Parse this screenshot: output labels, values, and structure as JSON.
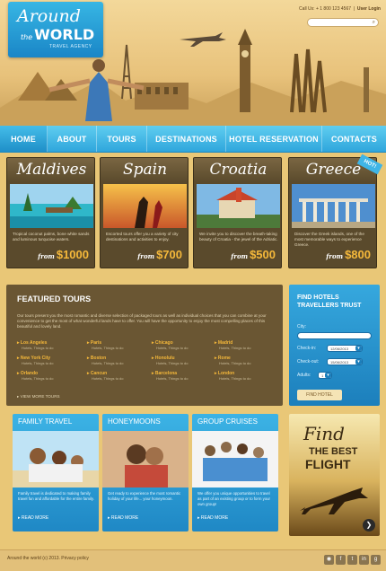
{
  "header": {
    "logo_line1": "Around",
    "logo_the": "the",
    "logo_line2": "WORLD",
    "logo_tagline": "TRAVEL AGENCY",
    "call_us": "Call Us: + 1 800 123 4567",
    "user_login": "User Login"
  },
  "nav": {
    "items": [
      "HOME",
      "ABOUT",
      "TOURS",
      "DESTINATIONS",
      "HOTEL RESERVATION",
      "CONTACTS"
    ]
  },
  "destinations": [
    {
      "name": "Maldives",
      "text": "Tropical coconut palms, bone white sands and luminous turquoise waters.",
      "from": "from",
      "price": "$1000"
    },
    {
      "name": "Spain",
      "text": "Escorted tours offer you a variety of city destinations and activities to enjoy.",
      "from": "from",
      "price": "$700"
    },
    {
      "name": "Croatia",
      "text": "We invite you to discover the breath-taking beauty of Croatia - the jewel of the Adriatic.",
      "from": "from",
      "price": "$500"
    },
    {
      "name": "Greece",
      "text": "Discover the Greek islands, one of the most memorable ways to experience Greece.",
      "from": "from",
      "price": "$800"
    }
  ],
  "hot_badge": "HOT!",
  "featured": {
    "title": "FEATURED TOURS",
    "description": "Our tours present you the most romantic and diverse selection of packaged tours as well as individual choices that you can combine at your convenience to get the most of what wonderful lands have to offer. You will have the opportunity to enjoy the most compelling places of this beautiful and lovely land.",
    "cities": [
      {
        "city": "Los Angeles",
        "sub": "Hotels, Things to do"
      },
      {
        "city": "Paris",
        "sub": "Hotels, Things to do"
      },
      {
        "city": "Chicago",
        "sub": "Hotels, Things to do"
      },
      {
        "city": "Madrid",
        "sub": "Hotels, Things to do"
      },
      {
        "city": "New York City",
        "sub": "Hotels, Things to do"
      },
      {
        "city": "Boston",
        "sub": "Hotels, Things to do"
      },
      {
        "city": "Honolulu",
        "sub": "Hotels, Things to do"
      },
      {
        "city": "Rome",
        "sub": "Hotels, Things to do"
      },
      {
        "city": "Orlando",
        "sub": "Hotels, Things to do"
      },
      {
        "city": "Cancun",
        "sub": "Hotels, Things to do"
      },
      {
        "city": "Barcelona",
        "sub": "Hotels, Things to do"
      },
      {
        "city": "London",
        "sub": "Hotels, Things to do"
      }
    ],
    "more_link": "VIEW MORE TOURS"
  },
  "hotels": {
    "title_line1": "FIND HOTELS",
    "title_line2": "TRAVELLERS TRUST",
    "city_label": "City:",
    "checkin_label": "Check-in:",
    "checkin_value": "12/06/2013",
    "checkout_label": "Check-out:",
    "checkout_value": "15/06/2013",
    "adults_label": "Adults:",
    "adults_value": "1",
    "button": "FIND HOTEL"
  },
  "panels": [
    {
      "title": "FAMILY TRAVEL",
      "text": "Family travel is dedicated to making family travel fun and affordable for the entire family.",
      "more": "READ MORE"
    },
    {
      "title": "HONEYMOONS",
      "text": "Get ready to experience the most romantic holiday of your life... your honeymoon.",
      "more": "READ MORE"
    },
    {
      "title": "GROUP CRUISES",
      "text": "We offer you unique opportunities to travel as part of an existing group or to form your own group!",
      "more": "READ MORE"
    }
  ],
  "ad": {
    "line1": "Find",
    "line2": "THE BEST",
    "line3": "FLIGHT",
    "arrow": "❯"
  },
  "footer": {
    "copyright": "Around the world (c) 2013. Privacy policy"
  },
  "colors": {
    "accent": "#2fa6dc",
    "price": "#f5b83a",
    "card": "#5a4a2c",
    "background": "#e9c777"
  }
}
